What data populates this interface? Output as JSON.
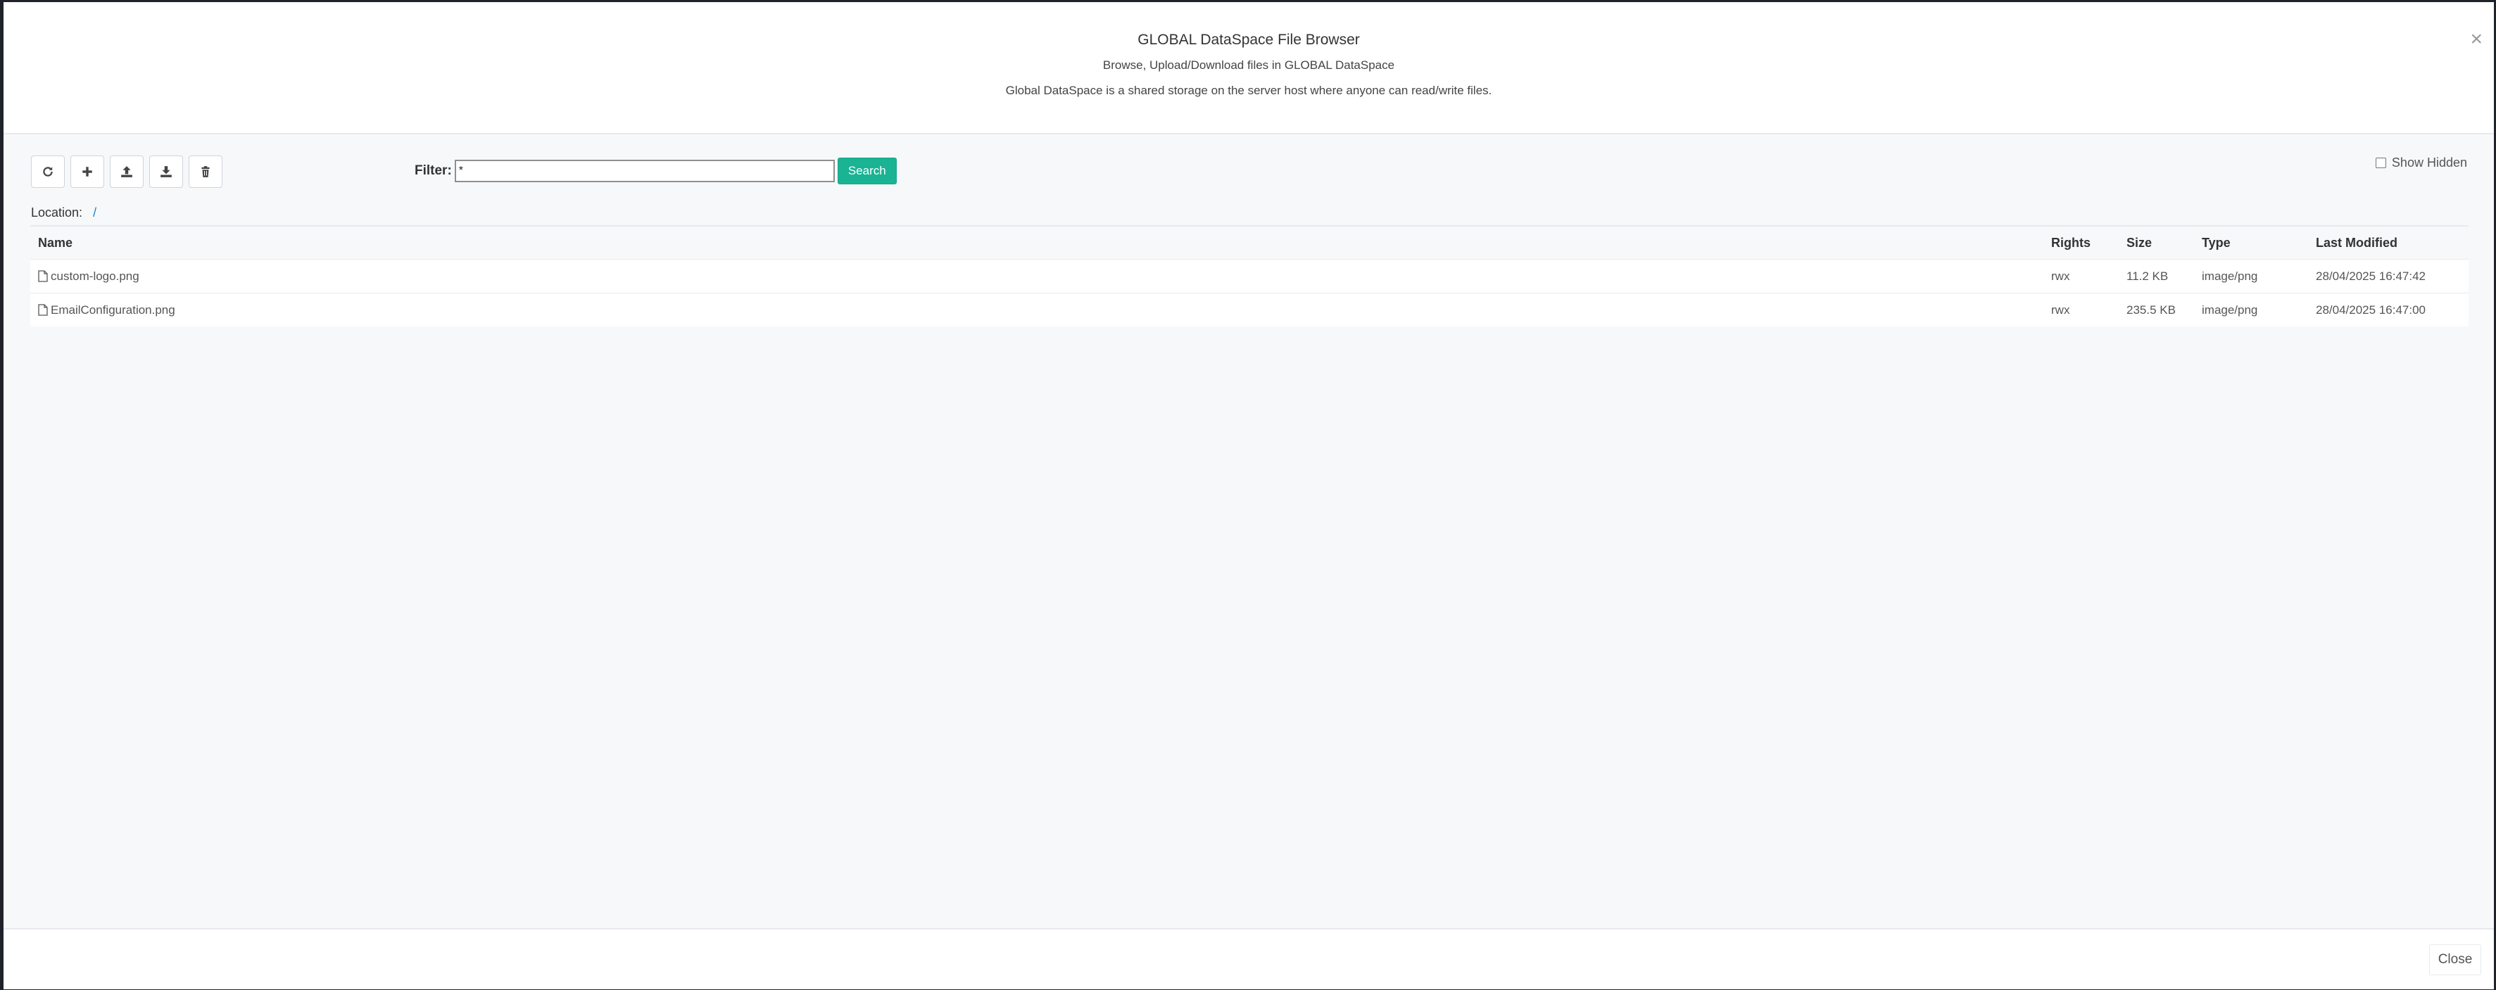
{
  "header": {
    "title": "GLOBAL DataSpace File Browser",
    "subtitle": "Browse, Upload/Download files in GLOBAL DataSpace",
    "description": "Global DataSpace is a shared storage on the server host where anyone can read/write files.",
    "close_glyph": "×"
  },
  "toolbar": {
    "icons": [
      "refresh-icon",
      "plus-icon",
      "upload-icon",
      "download-icon",
      "trash-icon"
    ]
  },
  "filter": {
    "label": "Filter:",
    "value": "*",
    "search_label": "Search"
  },
  "show_hidden": {
    "label": "Show Hidden",
    "checked": false
  },
  "location": {
    "label": "Location:",
    "path": "/"
  },
  "table": {
    "columns": [
      "Name",
      "Rights",
      "Size",
      "Type",
      "Last Modified"
    ],
    "rows": [
      {
        "name": "custom-logo.png",
        "rights": "rwx",
        "size": "11.2 KB",
        "type": "image/png",
        "modified": "28/04/2025 16:47:42"
      },
      {
        "name": "EmailConfiguration.png",
        "rights": "rwx",
        "size": "235.5 KB",
        "type": "image/png",
        "modified": "28/04/2025 16:47:00"
      }
    ]
  },
  "footer": {
    "close_label": "Close"
  },
  "colors": {
    "accent": "#1ab394",
    "link": "#1c84c6",
    "overlay": "#1f2329"
  }
}
